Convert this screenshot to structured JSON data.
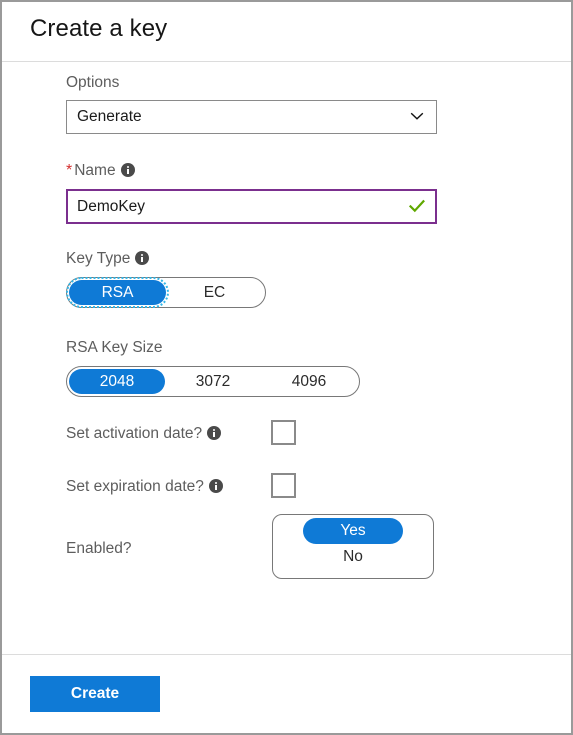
{
  "window": {
    "title": "Create a key"
  },
  "form": {
    "options": {
      "label": "Options",
      "value": "Generate",
      "chevron_icon": "chevron-down-icon"
    },
    "name": {
      "required_marker": "*",
      "label": "Name",
      "info_icon": "info-icon",
      "value": "DemoKey",
      "placeholder": "",
      "valid_icon": "checkmark-icon"
    },
    "key_type": {
      "label": "Key Type",
      "info_icon": "info-icon",
      "options": [
        "RSA",
        "EC"
      ],
      "selected": "RSA"
    },
    "rsa_key_size": {
      "label": "RSA Key Size",
      "options": [
        "2048",
        "3072",
        "4096"
      ],
      "selected": "2048"
    },
    "set_activation_date": {
      "label": "Set activation date?",
      "info_icon": "info-icon",
      "checked": false
    },
    "set_expiration_date": {
      "label": "Set expiration date?",
      "info_icon": "info-icon",
      "checked": false
    },
    "enabled": {
      "label": "Enabled?",
      "options": [
        "Yes",
        "No"
      ],
      "selected": "Yes"
    }
  },
  "footer": {
    "create_label": "Create"
  },
  "colors": {
    "accent": "#0f7ad6",
    "focus_ring": "#34b7e8",
    "input_focus_border": "#7b2f8e",
    "valid_check": "#5fa800",
    "required_asterisk": "#d42f2f",
    "label_text": "#5d5d5d",
    "value_text": "#1b1b1b",
    "window_border": "#9a9a9a",
    "divider": "#dcdcdc"
  }
}
